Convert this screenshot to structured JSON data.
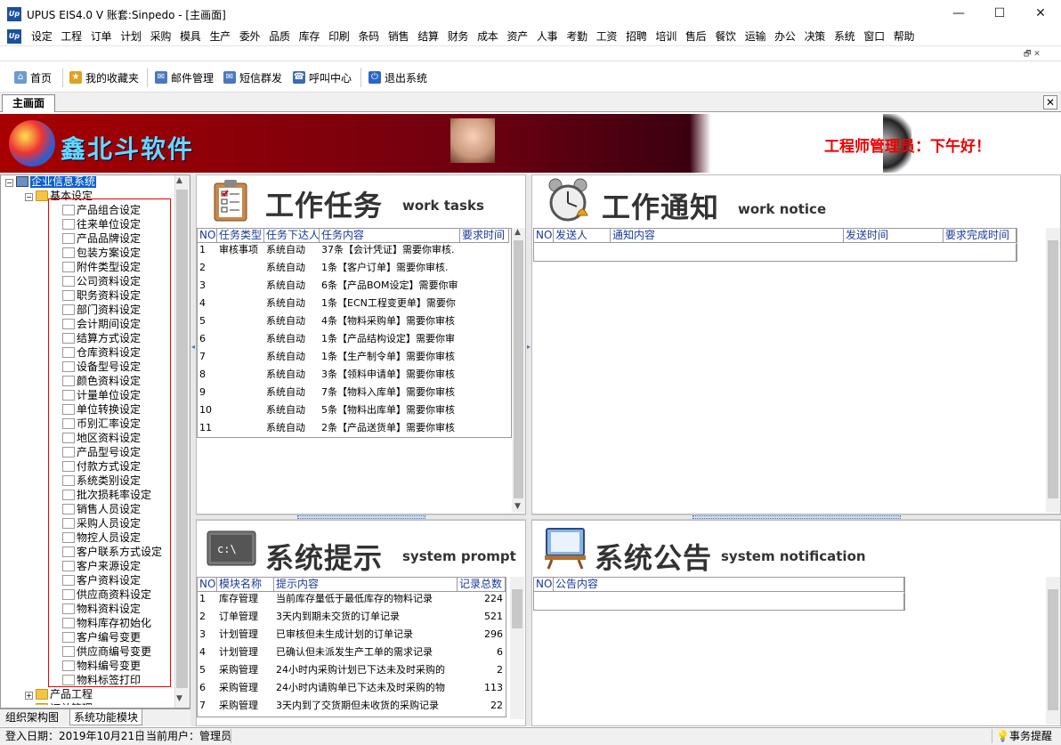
{
  "window": {
    "title": "UPUS EIS4.0 V 账套:Sinpedo - [主画面]",
    "app_icon": "Up",
    "minimize": "—",
    "maximize": "☐",
    "close": "✕"
  },
  "menu": [
    "设定",
    "工程",
    "订单",
    "计划",
    "采购",
    "模具",
    "生产",
    "委外",
    "品质",
    "库存",
    "印刷",
    "条码",
    "销售",
    "结算",
    "财务",
    "成本",
    "资产",
    "人事",
    "考勤",
    "工资",
    "招聘",
    "培训",
    "售后",
    "餐饮",
    "运输",
    "办公",
    "决策",
    "系统",
    "窗口",
    "帮助"
  ],
  "mdi_buttons": "🗗 ✕",
  "toolbar": {
    "home": "首页",
    "favorites": "我的收藏夹",
    "mail": "邮件管理",
    "sms": "短信群发",
    "callcenter": "呼叫中心",
    "exit": "退出系统"
  },
  "tabs": {
    "main": "主画面",
    "close": "✕"
  },
  "banner": {
    "logo_text": "鑫北斗软件",
    "greeting": "工程师管理员：下午好！"
  },
  "tree": {
    "root": "企业信息系统",
    "basic": "基本设定",
    "items": [
      "产品组合设定",
      "往来单位设定",
      "产品品牌设定",
      "包装方案设定",
      "附件类型设定",
      "公司资料设定",
      "职务资料设定",
      "部门资料设定",
      "会计期间设定",
      "结算方式设定",
      "仓库资料设定",
      "设备型号设定",
      "颜色资料设定",
      "计量单位设定",
      "单位转换设定",
      "币别汇率设定",
      "地区资料设定",
      "产品型号设定",
      "付款方式设定",
      "系统类别设定",
      "批次损耗率设定",
      "销售人员设定",
      "采购人员设定",
      "物控人员设定",
      "客户联系方式设定",
      "客户来源设定",
      "客户资料设定",
      "供应商资料设定",
      "物料资料设定",
      "物料库存初始化",
      "客户编号变更",
      "供应商编号变更",
      "物料编号变更",
      "物料标签打印"
    ],
    "product_eng": "产品工程",
    "order_mgmt": "订单管理"
  },
  "left_tabs": {
    "org": "组织架构图",
    "func": "系统功能模块"
  },
  "work_tasks": {
    "title": "工作任务",
    "title_en": "work tasks",
    "columns": [
      "NO.",
      "任务类型",
      "任务下达人",
      "任务内容",
      "要求时间"
    ],
    "rows": [
      [
        "1",
        "审核事项",
        "系统自动",
        "37条【会计凭证】需要你审核."
      ],
      [
        "2",
        "",
        "系统自动",
        "1条【客户订单】需要你审核."
      ],
      [
        "3",
        "",
        "系统自动",
        "6条【产品BOM设定】需要你审"
      ],
      [
        "4",
        "",
        "系统自动",
        "1条【ECN工程变更单】需要你"
      ],
      [
        "5",
        "",
        "系统自动",
        "4条【物料采购单】需要你审核"
      ],
      [
        "6",
        "",
        "系统自动",
        "1条【产品结构设定】需要你审"
      ],
      [
        "7",
        "",
        "系统自动",
        "1条【生产制令单】需要你审核"
      ],
      [
        "8",
        "",
        "系统自动",
        "3条【领料申请单】需要你审核"
      ],
      [
        "9",
        "",
        "系统自动",
        "7条【物料入库单】需要你审核"
      ],
      [
        "10",
        "",
        "系统自动",
        "5条【物料出库单】需要你审核"
      ],
      [
        "11",
        "",
        "系统自动",
        "2条【产品送货单】需要你审核"
      ]
    ]
  },
  "work_notice": {
    "title": "工作通知",
    "title_en": "work notice",
    "columns": [
      "NO.",
      "发送人",
      "通知内容",
      "发送时间",
      "要求完成时间"
    ]
  },
  "system_prompt": {
    "title": "系统提示",
    "title_en": "system prompt",
    "columns": [
      "NO.",
      "模块名称",
      "提示内容",
      "记录总数"
    ],
    "rows": [
      [
        "1",
        "库存管理",
        "当前库存量低于最低库存的物料记录",
        "224"
      ],
      [
        "2",
        "订单管理",
        "3天内到期未交货的订单记录",
        "521"
      ],
      [
        "3",
        "计划管理",
        "已审核但未生成计划的订单记录",
        "296"
      ],
      [
        "4",
        "计划管理",
        "已确认但未派发生产工单的需求记录",
        "6"
      ],
      [
        "5",
        "采购管理",
        "24小时内采购计划已下达未及时采购的",
        "2"
      ],
      [
        "6",
        "采购管理",
        "24小时内请购单已下达未及时采购的物",
        "113"
      ],
      [
        "7",
        "采购管理",
        "3天内到了交货期但未收货的采购记录",
        "22"
      ]
    ]
  },
  "system_notice": {
    "title": "系统公告",
    "title_en": "system notification",
    "columns": [
      "NO.",
      "公告内容"
    ]
  },
  "status": {
    "login_date": "登入日期：2019年10月21日",
    "current_user": "当前用户：管理员",
    "event_reminder": "事务提醒"
  }
}
